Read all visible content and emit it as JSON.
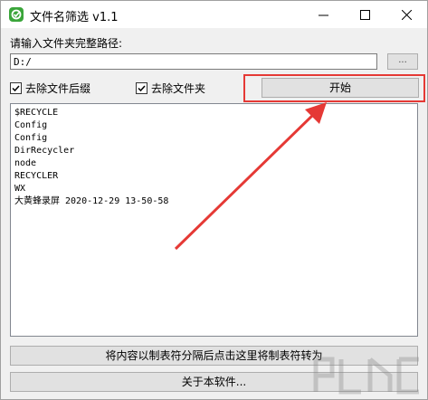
{
  "window": {
    "title": "文件名筛选 v1.1",
    "accent_color": "#e53935"
  },
  "form": {
    "path_label": "请输入文件夹完整路径:",
    "path_value": "D:/",
    "browse_label": "...",
    "checkbox_files_label": "去除文件后缀",
    "checkbox_files_checked": true,
    "checkbox_folders_label": "去除文件夹",
    "checkbox_folders_checked": true,
    "start_label": "开始"
  },
  "output": {
    "lines": [
      "$RECYCLE",
      "Config",
      "Config",
      "DirRecycler",
      "node",
      "RECYCLER",
      "WX",
      "大黄蜂录屏 2020-12-29 13-50-58"
    ]
  },
  "actions": {
    "convert_label": "将内容以制表符分隔后点击这里将制表符转为",
    "about_label": "关于本软件..."
  },
  "icons": {
    "app": "app-icon",
    "minimize": "minimize-icon",
    "maximize": "maximize-icon",
    "close": "close-icon",
    "check": "check-icon",
    "annotation_arrow": "red-arrow-icon"
  }
}
